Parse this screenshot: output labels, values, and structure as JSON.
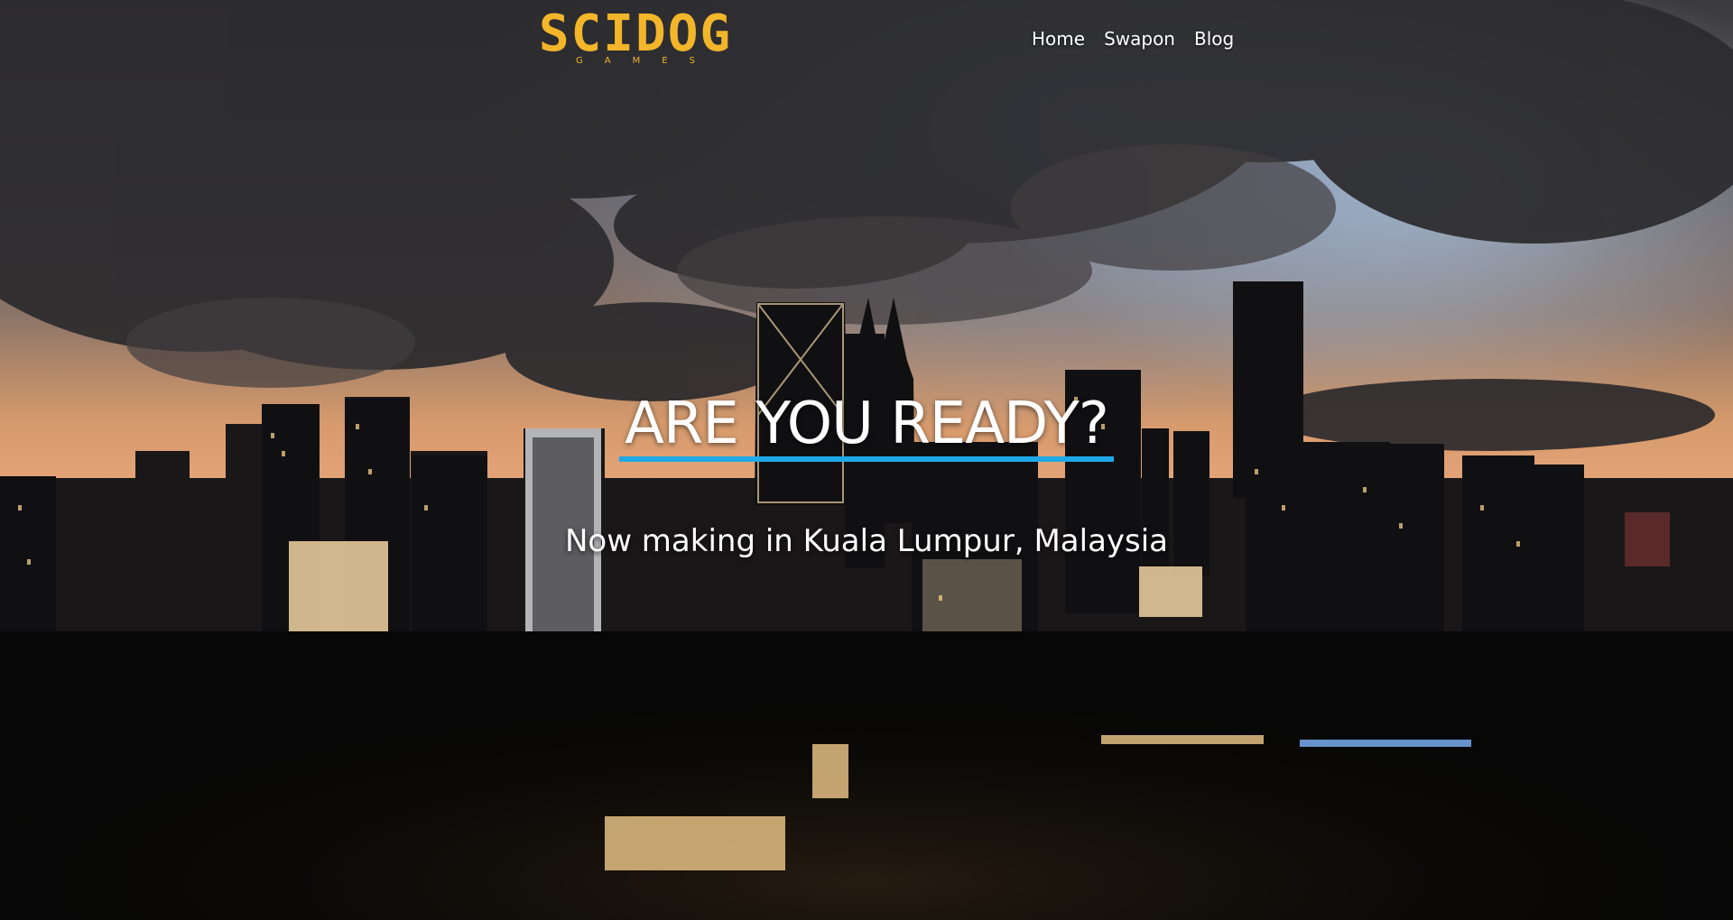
{
  "header": {
    "logo_text": "SCIDOG",
    "logo_subtext": "GAMES",
    "nav": [
      {
        "label": "Home"
      },
      {
        "label": "Swapon"
      },
      {
        "label": "Blog"
      }
    ]
  },
  "hero": {
    "title": "ARE YOU READY?",
    "subtitle": "Now making in Kuala Lumpur, Malaysia"
  },
  "colors": {
    "logo": "#f3b52a",
    "title_underline": "#1fa9e8",
    "text": "#ffffff"
  }
}
